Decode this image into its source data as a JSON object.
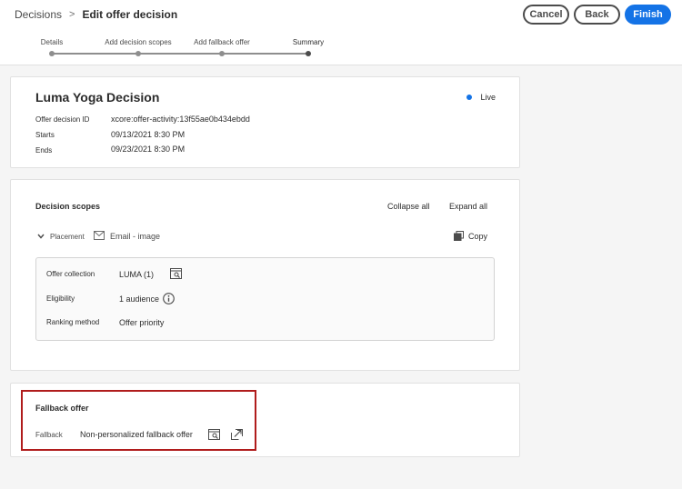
{
  "header": {
    "breadcrumb_parent": "Decisions",
    "breadcrumb_separator": ">",
    "breadcrumb_current": "Edit offer decision",
    "cancel_label": "Cancel",
    "back_label": "Back",
    "finish_label": "Finish"
  },
  "steps": [
    {
      "label": "Details"
    },
    {
      "label": "Add decision scopes"
    },
    {
      "label": "Add fallback offer"
    },
    {
      "label": "Summary"
    }
  ],
  "decision": {
    "name": "Luma Yoga Decision",
    "status": "Live",
    "id_label": "Offer decision ID",
    "id_value": "xcore:offer-activity:13f55ae0b434ebdd",
    "starts_label": "Starts",
    "starts_value": "09/13/2021 8:30 PM",
    "ends_label": "Ends",
    "ends_value": "09/23/2021 8:30 PM"
  },
  "scopes": {
    "title": "Decision scopes",
    "collapse_all": "Collapse all",
    "expand_all": "Expand all",
    "placement_label": "Placement",
    "placement_value": "Email - image",
    "copy_label": "Copy",
    "offer_collection_label": "Offer collection",
    "offer_collection_value": "LUMA (1)",
    "eligibility_label": "Eligibility",
    "eligibility_value": "1 audience",
    "ranking_label": "Ranking method",
    "ranking_value": "Offer priority"
  },
  "fallback": {
    "title": "Fallback offer",
    "label": "Fallback",
    "value": "Non-personalized fallback offer"
  },
  "colors": {
    "accent": "#1473e6",
    "highlight": "#b01c1c"
  }
}
